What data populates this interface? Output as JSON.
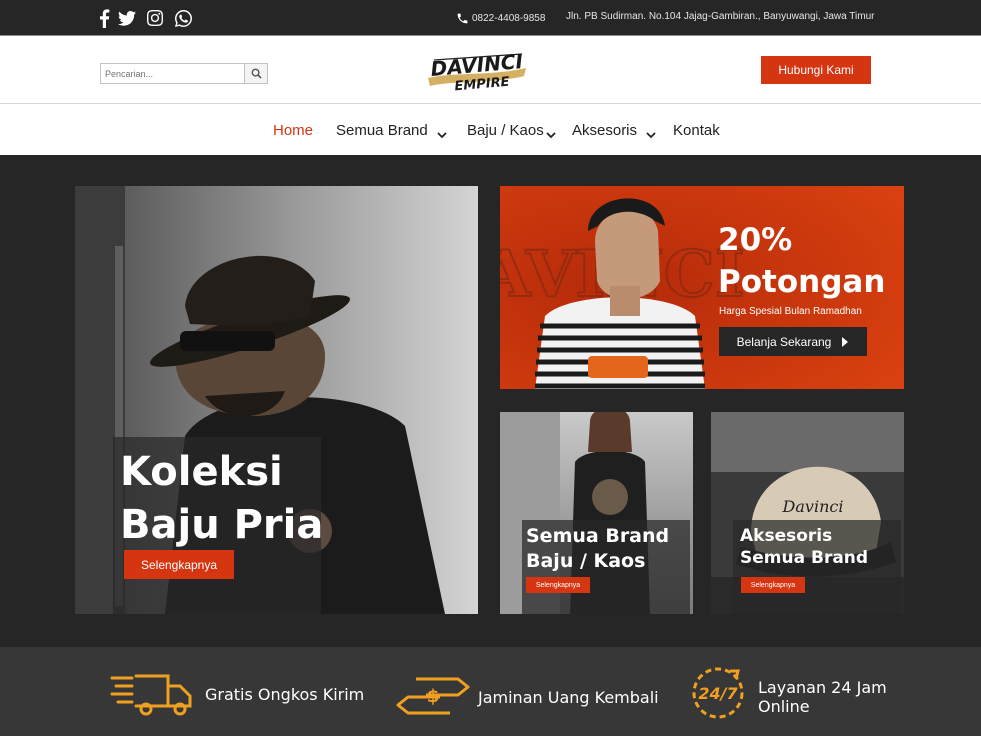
{
  "topbar": {
    "phone": "0822-4408-9858",
    "address": "Jln. PB Sudirman. No.104 Jajag-Gambiran., Banyuwangi, Jawa Timur",
    "social_icons": [
      "facebook-icon",
      "twitter-icon",
      "instagram-icon",
      "whatsapp-icon"
    ]
  },
  "header": {
    "search_placeholder": "Pencarian...",
    "logo_text_line1": "DAVINCI",
    "logo_text_line2": "EMPIRE",
    "contact_button": "Hubungi Kami"
  },
  "nav": {
    "items": [
      {
        "label": "Home",
        "active": true,
        "dropdown": false
      },
      {
        "label": "Semua Brand",
        "active": false,
        "dropdown": true
      },
      {
        "label": "Baju / Kaos",
        "active": false,
        "dropdown": true
      },
      {
        "label": "Aksesoris",
        "active": false,
        "dropdown": true
      },
      {
        "label": "Kontak",
        "active": false,
        "dropdown": false
      }
    ]
  },
  "hero": {
    "title_line1": "Koleksi",
    "title_line2": "Baju Pria",
    "button": "Selengkapnya"
  },
  "promo": {
    "title_line1": "20%",
    "title_line2": "Potongan",
    "subtitle": "Harga Spesial Bulan Ramadhan",
    "button": "Belanja Sekarang"
  },
  "card_brand": {
    "title_line1": "Semua Brand",
    "title_line2": "Baju / Kaos",
    "button": "Selengkapnya"
  },
  "card_accessories": {
    "title_line1": "Aksesoris",
    "title_line2": "Semua Brand",
    "button": "Selengkapnya"
  },
  "features": [
    {
      "icon": "delivery-truck-icon",
      "label": "Gratis Ongkos Kirim"
    },
    {
      "icon": "money-exchange-icon",
      "label": "Jaminan Uang Kembali"
    },
    {
      "icon": "clock-24-7-icon",
      "label_line1": "Layanan 24 Jam",
      "label_line2": "Online"
    }
  ],
  "colors": {
    "accent": "#d63511",
    "dark": "#262626",
    "feature_icon": "#f0a020"
  }
}
